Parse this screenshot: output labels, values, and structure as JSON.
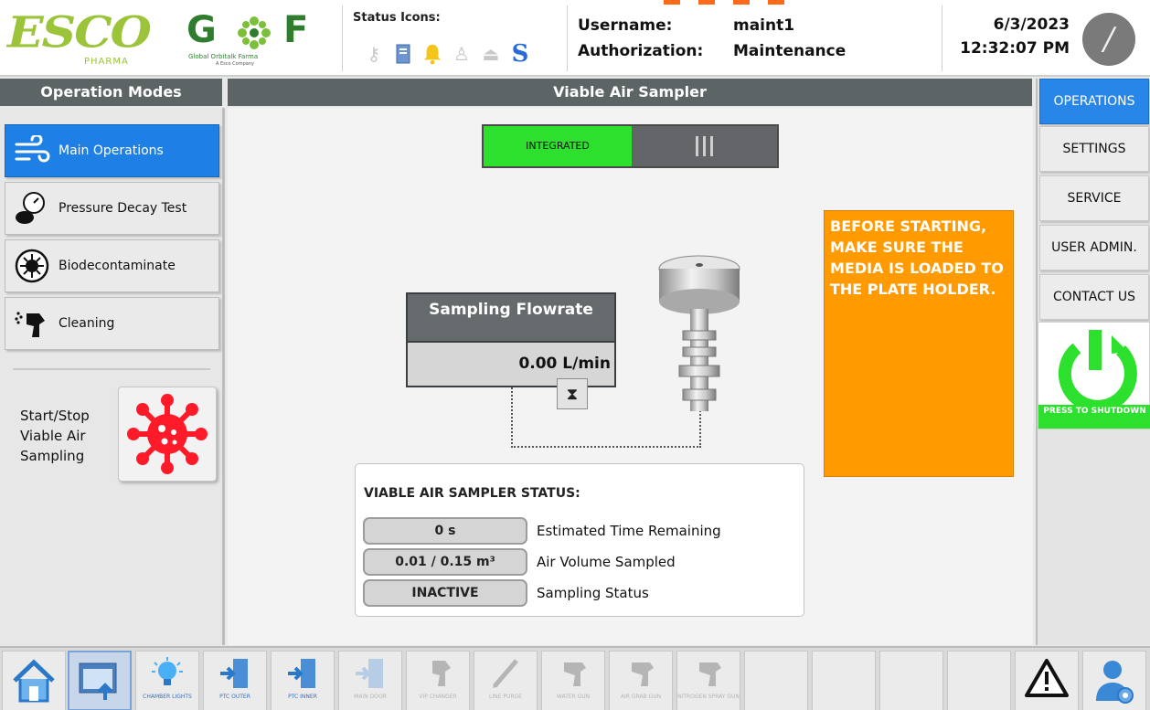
{
  "header": {
    "logo_esco": "ESCO",
    "logo_esco_sub": "PHARMA",
    "logo_gof_g": "G",
    "logo_gof_f": "F",
    "logo_gof_tag": "Global Orbitalk Farma",
    "logo_gof_tag2": "A Esco Company",
    "status_title": "Status Icons:",
    "status_icons": [
      "key-icon",
      "file-icon",
      "bell-icon",
      "person-warning-icon",
      "upload-icon",
      "s-icon"
    ],
    "username_label": "Username:",
    "username_value": "maint1",
    "authorization_label": "Authorization:",
    "authorization_value": "Maintenance",
    "date": "6/3/2023",
    "time": "12:32:07 PM"
  },
  "left": {
    "title": "Operation Modes",
    "modes": [
      {
        "label": "Main Operations",
        "icon": "wind-icon",
        "active": true
      },
      {
        "label": "Pressure Decay Test",
        "icon": "pressure-gauge-icon",
        "active": false
      },
      {
        "label": "Biodecontaminate",
        "icon": "virus-circle-icon",
        "active": false
      },
      {
        "label": "Cleaning",
        "icon": "spray-icon",
        "active": false
      }
    ],
    "startstop_label": "Start/Stop Viable Air Sampling"
  },
  "center": {
    "title": "Viable Air Sampler",
    "toggle_on_label": "INTEGRATED",
    "flowrate_title": "Sampling Flowrate",
    "flowrate_value": "0.00  L/min",
    "warning_text": "BEFORE STARTING, MAKE SURE THE MEDIA IS LOADED TO THE PLATE HOLDER.",
    "status_title": "VIABLE AIR SAMPLER STATUS:",
    "status_rows": [
      {
        "value": "0 s",
        "label": "Estimated Time Remaining"
      },
      {
        "value": "0.01 / 0.15 m³",
        "label": "Air Volume Sampled"
      },
      {
        "value": "INACTIVE",
        "label": "Sampling Status"
      }
    ]
  },
  "right": {
    "nav": [
      {
        "label": "OPERATIONS",
        "active": true
      },
      {
        "label": "SETTINGS",
        "active": false
      },
      {
        "label": "SERVICE",
        "active": false
      },
      {
        "label": "USER ADMIN.",
        "active": false
      },
      {
        "label": "CONTACT US",
        "active": false
      }
    ],
    "power_label": "PRESS TO SHUTDOWN"
  },
  "bottom": {
    "buttons": [
      {
        "caption": "",
        "icon": "home-icon"
      },
      {
        "caption": "",
        "icon": "window-upload-icon"
      },
      {
        "caption": "CHAMBER LIGHTS",
        "icon": "light-bulb-icon"
      },
      {
        "caption": "PTC OUTER",
        "icon": "door-outer-icon"
      },
      {
        "caption": "PTC INNER",
        "icon": "door-inner-icon"
      },
      {
        "caption": "MAIN DOOR",
        "icon": "main-door-icon"
      },
      {
        "caption": "VIP CHANGER",
        "icon": "vip-changer-icon"
      },
      {
        "caption": "LINE PURGE",
        "icon": "line-purge-icon"
      },
      {
        "caption": "WATER GUN",
        "icon": "water-gun-icon"
      },
      {
        "caption": "AIR GRAB GUN",
        "icon": "air-gun-icon"
      },
      {
        "caption": "NITROGEN SPRAY GUN",
        "icon": "nitrogen-gun-icon"
      }
    ]
  },
  "colors": {
    "title_bar": "#5c6465",
    "active_blue": "#1e7fe4",
    "integrated_green": "#2ee02e",
    "warning_orange": "#ff9b00",
    "virus_red": "#ff1a2a"
  }
}
